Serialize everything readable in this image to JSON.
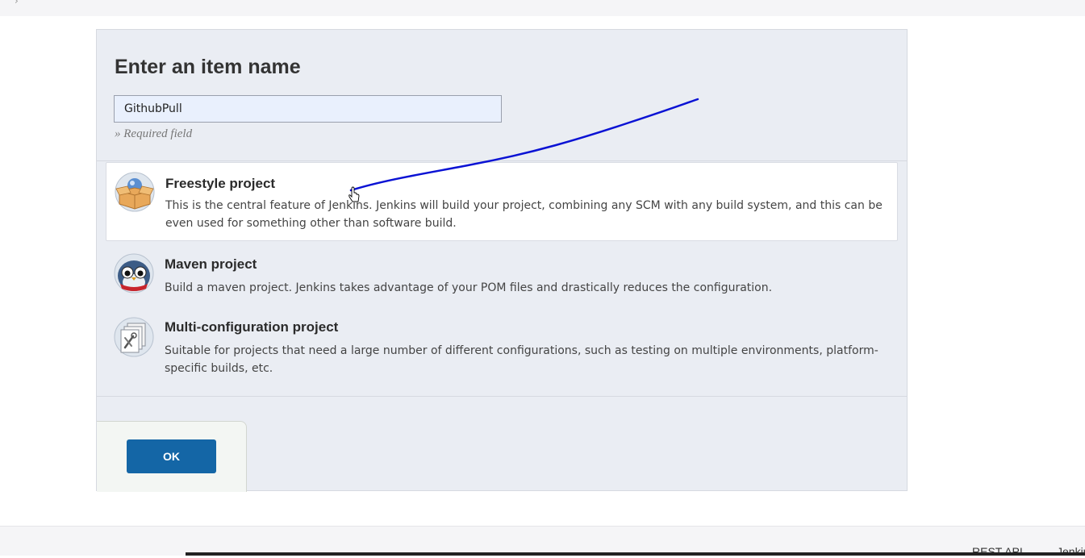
{
  "dialog": {
    "title": "Enter an item name",
    "item_name_value": "GithubPull",
    "required_hint": "» Required field"
  },
  "project_types": [
    {
      "title": "Freestyle project",
      "description": "This is the central feature of Jenkins. Jenkins will build your project, combining any SCM with any build system, and this can be even used for something other than software build.",
      "icon": "freestyle-project-icon",
      "selected": true
    },
    {
      "title": "Maven project",
      "description": "Build a maven project. Jenkins takes advantage of your POM files and drastically reduces the configuration.",
      "icon": "maven-project-icon",
      "selected": false
    },
    {
      "title": "Multi-configuration project",
      "description": "Suitable for projects that need a large number of different configurations, such as testing on multiple environments, platform-specific builds, etc.",
      "icon": "multi-configuration-icon",
      "selected": false
    }
  ],
  "actions": {
    "ok_label": "OK"
  },
  "footer": {
    "rest_api_label": "REST API",
    "jenkins_label": "Jenkins"
  },
  "colors": {
    "panel_bg": "#eaedf3",
    "ok_button": "#1466a6",
    "annotation_stroke": "#0a12d4",
    "input_bg": "#e9f0fd"
  }
}
